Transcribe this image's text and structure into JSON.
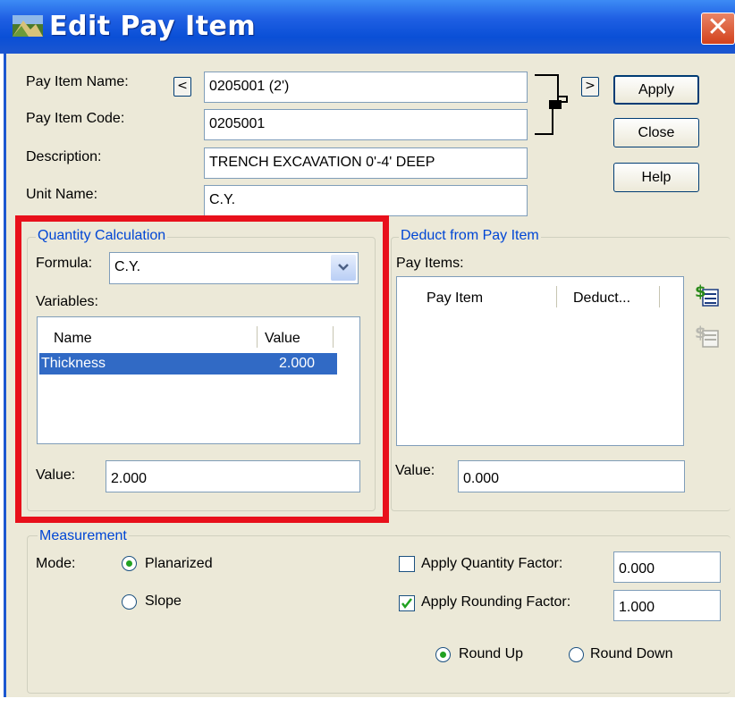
{
  "window": {
    "title": "Edit Pay Item",
    "close_glyph": "✕"
  },
  "form": {
    "pay_item_name_label": "Pay Item Name:",
    "pay_item_name_value": "0205001 (2')",
    "pay_item_code_label": "Pay Item Code:",
    "pay_item_code_value": "0205001",
    "description_label": "Description:",
    "description_value": "TRENCH EXCAVATION 0'-4' DEEP",
    "unit_name_label": "Unit Name:",
    "unit_name_value": "C.Y.",
    "prev_glyph": "<",
    "next_glyph": ">"
  },
  "buttons": {
    "apply": "Apply",
    "close": "Close",
    "help": "Help"
  },
  "quantity_calc": {
    "legend": "Quantity Calculation",
    "formula_label": "Formula:",
    "formula_value": "C.Y.",
    "variables_label": "Variables:",
    "columns": [
      "Name",
      "Value"
    ],
    "rows": [
      {
        "name": "Thickness",
        "value": "2.000",
        "selected": true
      }
    ],
    "value_label": "Value:",
    "value": "2.000"
  },
  "deduct": {
    "legend": "Deduct from Pay Item",
    "pay_items_label": "Pay Items:",
    "columns": [
      "Pay Item",
      "Deduct..."
    ],
    "value_label": "Value:",
    "value": "0.000",
    "add_icon": "add-pay-item-icon",
    "remove_icon": "remove-pay-item-icon"
  },
  "measurement": {
    "legend": "Measurement",
    "mode_label": "Mode:",
    "mode_options": [
      "Planarized",
      "Slope"
    ],
    "mode_selected": "Planarized",
    "apply_quantity_factor_label": "Apply Quantity Factor:",
    "apply_quantity_factor_checked": false,
    "apply_quantity_factor_value": "0.000",
    "apply_rounding_factor_label": "Apply Rounding Factor:",
    "apply_rounding_factor_checked": true,
    "apply_rounding_factor_value": "1.000",
    "round_options": [
      "Round Up",
      "Round Down"
    ],
    "round_selected": "Round Up"
  },
  "colors": {
    "titlebar": "#0a4fd6",
    "dialog_bg": "#ece9d8",
    "group_legend": "#0046d5",
    "selection": "#316ac5",
    "highlight_box": "#e8101b"
  }
}
